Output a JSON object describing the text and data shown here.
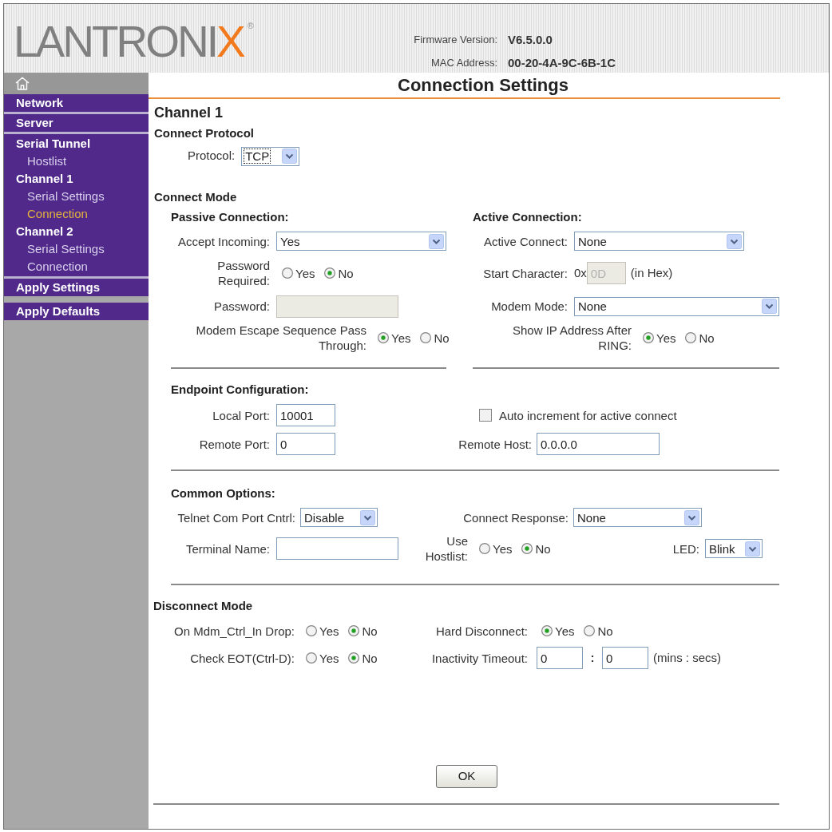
{
  "header": {
    "logo": {
      "name": "LANTRONI",
      "accent": "X",
      "mark": "®"
    },
    "firmware": {
      "label": "Firmware Version:",
      "value": "V6.5.0.0"
    },
    "mac": {
      "label": "MAC Address:",
      "value": "00-20-4A-9C-6B-1C"
    }
  },
  "sidebar": {
    "groups": [
      {
        "items": [
          {
            "label": "Network",
            "kind": "section",
            "selected": false
          }
        ]
      },
      {
        "items": [
          {
            "label": "Server",
            "kind": "section",
            "selected": false
          }
        ]
      },
      {
        "items": [
          {
            "label": "Serial Tunnel",
            "kind": "section",
            "selected": false
          },
          {
            "label": "Hostlist",
            "kind": "page",
            "selected": false
          },
          {
            "label": "Channel 1",
            "kind": "section",
            "selected": false
          },
          {
            "label": "Serial Settings",
            "kind": "page",
            "selected": false
          },
          {
            "label": "Connection",
            "kind": "page",
            "selected": true
          },
          {
            "label": "Channel 2",
            "kind": "section",
            "selected": false
          },
          {
            "label": "Serial Settings",
            "kind": "page",
            "selected": false
          },
          {
            "label": "Connection",
            "kind": "page",
            "selected": false
          }
        ]
      },
      {
        "items": [
          {
            "label": "Apply Settings",
            "kind": "section",
            "selected": false
          }
        ]
      },
      {
        "items": [
          {
            "label": "Apply Defaults",
            "kind": "section",
            "selected": false
          }
        ]
      }
    ]
  },
  "page": {
    "title": "Connection Settings",
    "channel": "Channel 1"
  },
  "connect_protocol": {
    "heading": "Connect Protocol",
    "protocol": {
      "label": "Protocol:",
      "value": "TCP",
      "focused": true
    }
  },
  "connect_mode": {
    "heading": "Connect Mode",
    "passive": {
      "heading": "Passive Connection:",
      "accept_incoming": {
        "label": "Accept Incoming:",
        "value": "Yes"
      },
      "password_required": {
        "label": "Password Required:",
        "options": [
          {
            "label": "Yes",
            "selected": false
          },
          {
            "label": "No",
            "selected": true
          }
        ]
      },
      "password": {
        "label": "Password:",
        "disabled": true
      },
      "modem_escape": {
        "label": "Modem Escape Sequence Pass Through:",
        "options": [
          {
            "label": "Yes",
            "selected": true
          },
          {
            "label": "No",
            "selected": false
          }
        ]
      }
    },
    "active": {
      "heading": "Active Connection:",
      "active_connect": {
        "label": "Active Connect:",
        "value": "None"
      },
      "start_character": {
        "label": "Start Character:",
        "prefix": "0x",
        "value": "0D",
        "disabled": true,
        "unit": "(in Hex)"
      },
      "modem_mode": {
        "label": "Modem Mode:",
        "value": "None"
      },
      "show_ip": {
        "label": "Show IP Address After RING:",
        "options": [
          {
            "label": "Yes",
            "selected": true
          },
          {
            "label": "No",
            "selected": false
          }
        ]
      }
    }
  },
  "endpoint": {
    "heading": "Endpoint Configuration:",
    "local_port": {
      "label": "Local Port:",
      "value": "10001"
    },
    "auto_increment": {
      "label": "Auto increment for active connect",
      "checked": false
    },
    "remote_port": {
      "label": "Remote Port:",
      "value": "0"
    },
    "remote_host": {
      "label": "Remote Host:",
      "value": "0.0.0.0"
    }
  },
  "common": {
    "heading": "Common Options:",
    "telnet": {
      "label": "Telnet Com Port Cntrl:",
      "value": "Disable"
    },
    "connect_response": {
      "label": "Connect Response:",
      "value": "None"
    },
    "terminal_name": {
      "label": "Terminal Name:"
    },
    "use_hostlist": {
      "label": "Use Hostlist:",
      "options": [
        {
          "label": "Yes",
          "selected": false
        },
        {
          "label": "No",
          "selected": true
        }
      ]
    },
    "led": {
      "label": "LED:",
      "value": "Blink"
    }
  },
  "disconnect": {
    "heading": "Disconnect Mode",
    "mdm_ctrl_drop": {
      "label": "On Mdm_Ctrl_In Drop:",
      "options": [
        {
          "label": "Yes",
          "selected": false
        },
        {
          "label": "No",
          "selected": true
        }
      ]
    },
    "hard_disconnect": {
      "label": "Hard Disconnect:",
      "options": [
        {
          "label": "Yes",
          "selected": true
        },
        {
          "label": "No",
          "selected": false
        }
      ]
    },
    "check_eot": {
      "label": "Check EOT(Ctrl-D):",
      "options": [
        {
          "label": "Yes",
          "selected": false
        },
        {
          "label": "No",
          "selected": true
        }
      ]
    },
    "inactivity_timeout": {
      "label": "Inactivity Timeout:",
      "minutes": "0",
      "separator": ":",
      "seconds": "0",
      "unit": "(mins : secs)"
    }
  },
  "buttons": [
    {
      "label": "OK"
    }
  ]
}
